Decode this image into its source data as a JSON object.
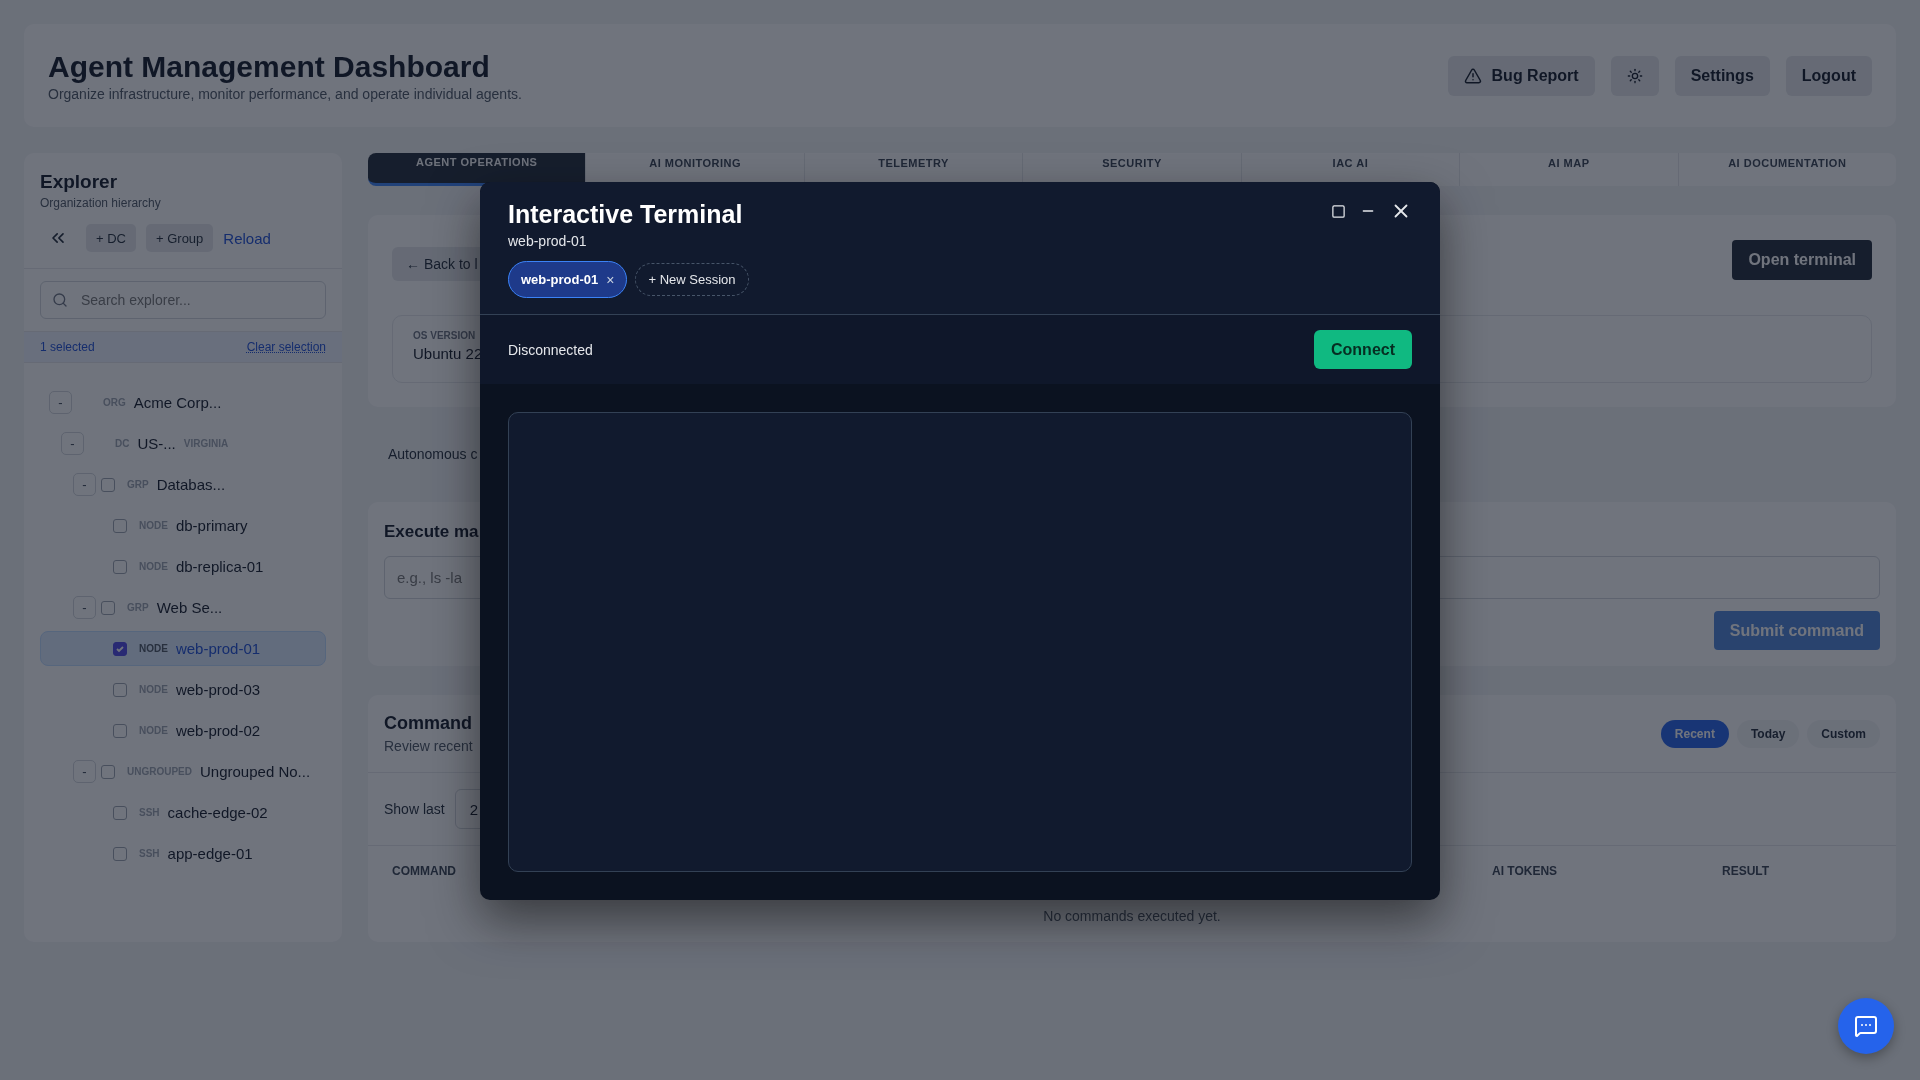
{
  "header": {
    "title": "Agent Management Dashboard",
    "subtitle": "Organize infrastructure, monitor performance, and operate individual agents.",
    "actions": [
      {
        "kind": "icon-label",
        "label": "Bug Report"
      },
      {
        "kind": "icon"
      },
      {
        "kind": "text",
        "label": "Settings"
      },
      {
        "kind": "text",
        "label": "Logout"
      }
    ]
  },
  "sidebar": {
    "title": "Explorer",
    "subtitle": "Organization hierarchy",
    "tools": [
      {
        "kind": "collapse"
      },
      {
        "kind": "button",
        "label": "+ DC"
      },
      {
        "kind": "button",
        "label": "+ Group"
      },
      {
        "kind": "link",
        "label": "Reload"
      }
    ],
    "search": {
      "placeholder": "Search explorer..."
    },
    "selection": {
      "count": "1 selected",
      "clear": "Clear selection"
    },
    "tree": [
      {
        "type": "ORG",
        "name": "Acme Corp...",
        "toggle": "-",
        "selected": false,
        "children": [
          {
            "type": "DC",
            "name": "US-...",
            "region": "VIRGINIA",
            "toggle": "-",
            "selected": false,
            "children": [
              {
                "type": "GRP",
                "name": "Databas...",
                "toggle": "-",
                "checked": false,
                "selected": false,
                "children": [
                  {
                    "type": "NODE",
                    "name": "db-primary",
                    "checked": false,
                    "selected": false
                  },
                  {
                    "type": "NODE",
                    "name": "db-replica-01",
                    "checked": false,
                    "selected": false
                  }
                ]
              },
              {
                "type": "GRP",
                "name": "Web Se...",
                "toggle": "-",
                "checked": false,
                "selected": false,
                "children": [
                  {
                    "type": "NODE",
                    "name": "web-prod-01",
                    "checked": true,
                    "selected": true
                  },
                  {
                    "type": "NODE",
                    "name": "web-prod-03",
                    "checked": false,
                    "selected": false
                  },
                  {
                    "type": "NODE",
                    "name": "web-prod-02",
                    "checked": false,
                    "selected": false
                  }
                ]
              },
              {
                "type": "UNGROUPED",
                "name": "Ungrouped No...",
                "toggle": "-",
                "checked": false,
                "selected": false,
                "children": [
                  {
                    "type": "SSH",
                    "name": "cache-edge-02",
                    "checked": false,
                    "selected": false
                  },
                  {
                    "type": "SSH",
                    "name": "app-edge-01",
                    "checked": false,
                    "selected": false
                  }
                ]
              }
            ]
          }
        ]
      }
    ]
  },
  "tabs": [
    {
      "label": "AGENT OPERATIONS",
      "selected": true
    },
    {
      "label": "AI MONITORING",
      "selected": false
    },
    {
      "label": "TELEMETRY",
      "selected": false
    },
    {
      "label": "SECURITY",
      "selected": false
    },
    {
      "label": "IAC AI",
      "selected": false
    },
    {
      "label": "AI MAP",
      "selected": false
    },
    {
      "label": "AI DOCUMENTATION",
      "selected": false
    }
  ],
  "agent": {
    "back": "← Back to l",
    "open_terminal": "Open terminal",
    "os_label": "OS VERSION",
    "os_value": "Ubuntu 22"
  },
  "autonomous": "Autonomous c",
  "execute": {
    "title": "Execute ma",
    "placeholder": "e.g., ls -la",
    "submit": "Submit command"
  },
  "history": {
    "title": "Command",
    "subtitle": "Review recent",
    "filters": [
      {
        "label": "Recent",
        "selected": true
      },
      {
        "label": "Today",
        "selected": false
      },
      {
        "label": "Custom",
        "selected": false
      }
    ],
    "show_last": "Show last",
    "show_value": "2",
    "columns": [
      {
        "label": "COMMAND"
      },
      {
        "label": "AI TOKENS"
      },
      {
        "label": "RESULT"
      }
    ],
    "empty": "No commands executed yet."
  },
  "terminal": {
    "title": "Interactive Terminal",
    "subtitle": "web-prod-01",
    "sessions": [
      {
        "label": "web-prod-01",
        "close": "×",
        "selected": true
      }
    ],
    "new_session": "+ New Session",
    "status": "Disconnected",
    "connect": "Connect"
  }
}
